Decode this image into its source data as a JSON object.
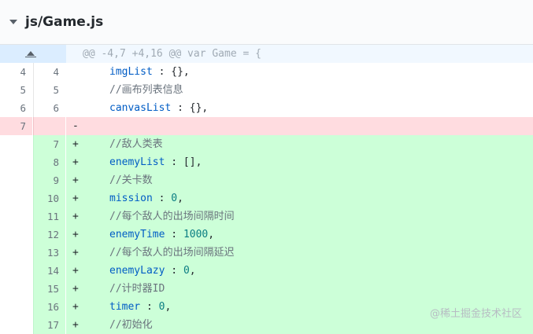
{
  "file": {
    "name": "js/Game.js"
  },
  "hunk": {
    "header": "@@ -4,7 +4,16 @@ var Game = {"
  },
  "lines": [
    {
      "type": "ctx",
      "old": "4",
      "new": "4",
      "marker": "",
      "parts": [
        [
          "ident",
          "imgList"
        ],
        [
          "punc",
          " : {},"
        ]
      ]
    },
    {
      "type": "ctx",
      "old": "5",
      "new": "5",
      "marker": "",
      "parts": [
        [
          "comment",
          "//画布列表信息"
        ]
      ]
    },
    {
      "type": "ctx",
      "old": "6",
      "new": "6",
      "marker": "",
      "parts": [
        [
          "ident",
          "canvasList"
        ],
        [
          "punc",
          " : {},"
        ]
      ]
    },
    {
      "type": "del",
      "old": "7",
      "new": "",
      "marker": "-",
      "parts": []
    },
    {
      "type": "add",
      "old": "",
      "new": "7",
      "marker": "+",
      "parts": [
        [
          "comment",
          "//敌人类表"
        ]
      ]
    },
    {
      "type": "add",
      "old": "",
      "new": "8",
      "marker": "+",
      "parts": [
        [
          "ident",
          "enemyList"
        ],
        [
          "punc",
          " : [],"
        ]
      ]
    },
    {
      "type": "add",
      "old": "",
      "new": "9",
      "marker": "+",
      "parts": [
        [
          "comment",
          "//关卡数"
        ]
      ]
    },
    {
      "type": "add",
      "old": "",
      "new": "10",
      "marker": "+",
      "parts": [
        [
          "ident",
          "mission"
        ],
        [
          "punc",
          " : "
        ],
        [
          "num",
          "0"
        ],
        [
          "punc",
          ","
        ]
      ]
    },
    {
      "type": "add",
      "old": "",
      "new": "11",
      "marker": "+",
      "parts": [
        [
          "comment",
          "//每个敌人的出场间隔时间"
        ]
      ]
    },
    {
      "type": "add",
      "old": "",
      "new": "12",
      "marker": "+",
      "parts": [
        [
          "ident",
          "enemyTime"
        ],
        [
          "punc",
          " : "
        ],
        [
          "num",
          "1000"
        ],
        [
          "punc",
          ","
        ]
      ]
    },
    {
      "type": "add",
      "old": "",
      "new": "13",
      "marker": "+",
      "parts": [
        [
          "comment",
          "//每个敌人的出场间隔延迟"
        ]
      ]
    },
    {
      "type": "add",
      "old": "",
      "new": "14",
      "marker": "+",
      "parts": [
        [
          "ident",
          "enemyLazy"
        ],
        [
          "punc",
          " : "
        ],
        [
          "num",
          "0"
        ],
        [
          "punc",
          ","
        ]
      ]
    },
    {
      "type": "add",
      "old": "",
      "new": "15",
      "marker": "+",
      "parts": [
        [
          "comment",
          "//计时器ID"
        ]
      ]
    },
    {
      "type": "add",
      "old": "",
      "new": "16",
      "marker": "+",
      "parts": [
        [
          "ident",
          "timer"
        ],
        [
          "punc",
          " : "
        ],
        [
          "num",
          "0"
        ],
        [
          "punc",
          ","
        ]
      ]
    },
    {
      "type": "add",
      "old": "",
      "new": "17",
      "marker": "+",
      "parts": [
        [
          "comment",
          "//初始化"
        ]
      ]
    }
  ],
  "watermark": "@稀土掘金技术社区"
}
